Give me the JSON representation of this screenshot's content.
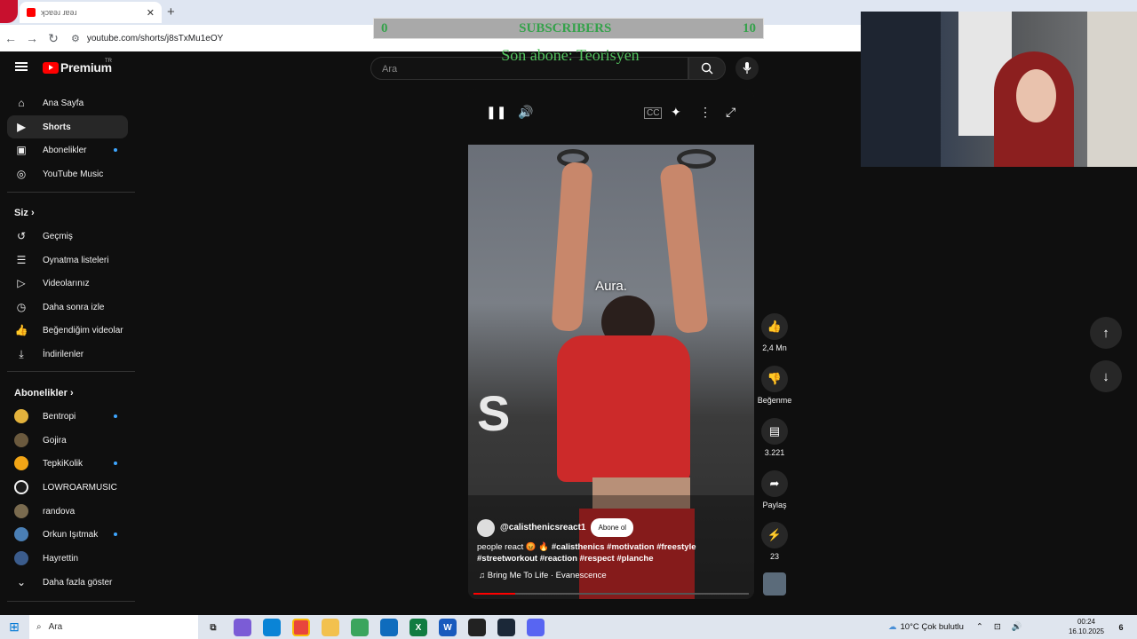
{
  "browser": {
    "tab_title": "ʞɔɐǝɹ ɹɐǝɹ",
    "url": "youtube.com/shorts/j8sTxMu1eOY"
  },
  "overlay": {
    "subscribers_left": "0",
    "subscribers_label": "SUBSCRIBERS",
    "subscribers_right": "10",
    "last_subscriber": "Son abone: Teorisyen"
  },
  "header": {
    "logo_text": "Premium",
    "country_code": "TR",
    "search_placeholder": "Ara"
  },
  "sidebar": {
    "main": [
      {
        "label": "Ana Sayfa",
        "icon": "home-icon"
      },
      {
        "label": "Shorts",
        "icon": "shorts-icon",
        "active": true
      },
      {
        "label": "Abonelikler",
        "icon": "subscriptions-icon",
        "dot": true
      },
      {
        "label": "YouTube Music",
        "icon": "youtube-music-icon"
      }
    ],
    "you_header": "Siz",
    "you": [
      {
        "label": "Geçmiş",
        "icon": "history-icon"
      },
      {
        "label": "Oynatma listeleri",
        "icon": "playlists-icon"
      },
      {
        "label": "Videolarınız",
        "icon": "your-videos-icon"
      },
      {
        "label": "Daha sonra izle",
        "icon": "watch-later-icon"
      },
      {
        "label": "Beğendiğim videolar",
        "icon": "liked-videos-icon"
      },
      {
        "label": "İndirilenler",
        "icon": "downloads-icon"
      }
    ],
    "subs_header": "Abonelikler",
    "subs": [
      {
        "label": "Bentropi",
        "color": "#e3b23c",
        "dot": true
      },
      {
        "label": "Gojira",
        "color": "#6b5a3e"
      },
      {
        "label": "TepkiKolik",
        "color": "#f2a516",
        "dot": true
      },
      {
        "label": "LOWROARMUSIC",
        "color": "#f1f1f1"
      },
      {
        "label": "randova",
        "color": "#7a6b4f"
      },
      {
        "label": "Orkun Işıtmak",
        "color": "#4a7fb5",
        "dot": true
      },
      {
        "label": "Hayrettin",
        "color": "#3b5c8c"
      }
    ],
    "show_more": "Daha fazla göster"
  },
  "video": {
    "caption": "Aura.",
    "channel": "@calisthenicsreact1",
    "subscribe_label": "Abone ol",
    "description_plain": "people react 😡 🔥 ",
    "description_tags": "#calisthenics #motivation #freestyle #streetworkout #reaction #respect #planche",
    "music": "Bring Me To Life · Evanescence",
    "progress": 0.15
  },
  "actions": {
    "likes": "2,4 Mn",
    "dislike": "Beğenme",
    "comments": "3.221",
    "share": "Paylaş",
    "remix": "23"
  },
  "taskbar": {
    "search": "Ara",
    "weather": "10°C  Çok bulutlu",
    "time": "00:24",
    "date": "16.10.2025",
    "notifications": "6"
  }
}
